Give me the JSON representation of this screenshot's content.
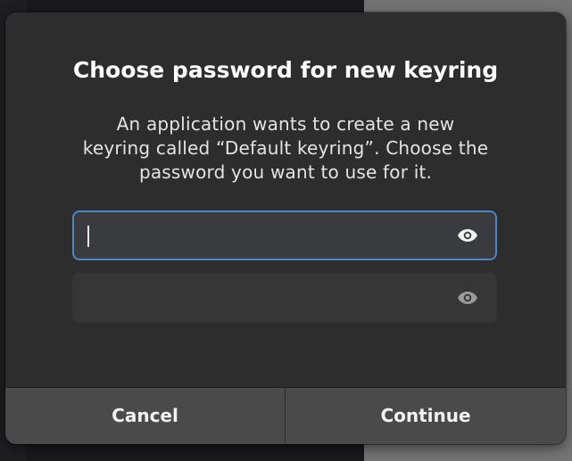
{
  "dialog": {
    "title": "Choose password for new keyring",
    "message_lines": [
      "An application wants to create a new",
      "keyring called “Default keyring”. Choose the",
      "password you want to use for it."
    ],
    "password_field": {
      "value": "",
      "focused": true,
      "icon": "eye-icon"
    },
    "confirm_field": {
      "value": "",
      "icon": "eye-icon"
    },
    "buttons": {
      "cancel": "Cancel",
      "continue": "Continue"
    }
  },
  "colors": {
    "dialog_bg": "#2d2d2d",
    "focus_border": "#4a86c8",
    "button_bg": "#4a4a4a"
  }
}
